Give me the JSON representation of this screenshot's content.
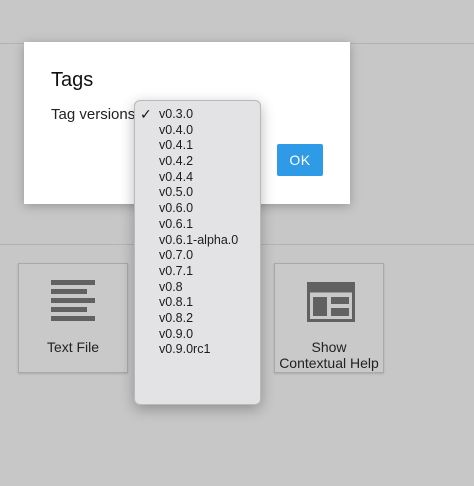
{
  "dialog": {
    "title": "Tags",
    "field_label": "Tag versions",
    "ok_label": "OK"
  },
  "dropdown": {
    "selected": "v0.3.0",
    "check_glyph": "✓",
    "options": [
      "v0.3.0",
      "v0.4.0",
      "v0.4.1",
      "v0.4.2",
      "v0.4.4",
      "v0.5.0",
      "v0.6.0",
      "v0.6.1",
      "v0.6.1-alpha.0",
      "v0.7.0",
      "v0.7.1",
      "v0.8",
      "v0.8.1",
      "v0.8.2",
      "v0.9.0",
      "v0.9.0rc1"
    ]
  },
  "tiles": {
    "text_file": {
      "label": "Text File",
      "icon": "text-lines-icon"
    },
    "contextual_help": {
      "label": "Show Contextual Help",
      "label_line1": "Show",
      "label_line2": "Contextual Help",
      "icon": "layout-panel-icon"
    }
  },
  "colors": {
    "ok_button": "#2f9be6",
    "backdrop": "#c7c7c7",
    "dialog_bg": "#ffffff",
    "dropdown_bg": "#e3e2e4"
  }
}
